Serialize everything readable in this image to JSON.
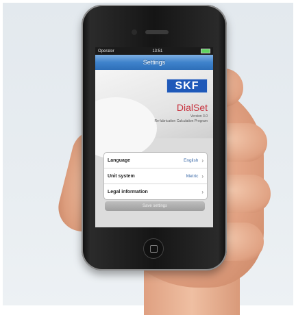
{
  "status_bar": {
    "carrier": "Operator",
    "time": "13:51"
  },
  "nav": {
    "title": "Settings"
  },
  "hero": {
    "logo_text": "SKF",
    "app_name": "DialSet",
    "version": "Version 3.0",
    "subtitle": "Re-lubrication Calculation Program"
  },
  "settings": {
    "rows": [
      {
        "label": "Language",
        "value": "English"
      },
      {
        "label": "Unit system",
        "value": "Metric"
      },
      {
        "label": "Legal information",
        "value": ""
      }
    ],
    "save_label": "Save settings"
  },
  "colors": {
    "brand_blue": "#1f59b9",
    "accent_red": "#c8313d",
    "nav_blue": "#3f83cc"
  }
}
